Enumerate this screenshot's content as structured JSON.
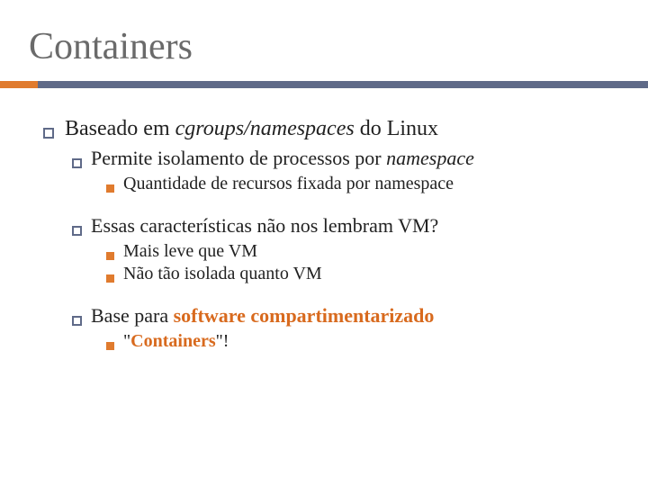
{
  "title": "Containers",
  "l1_prefix": "Baseado em ",
  "l1_emph": "cgroups/namespaces",
  "l1_suffix": " do Linux",
  "g1": {
    "l2_prefix": "Permite isolamento de processos por ",
    "l2_emph": "namespace",
    "l3_1": "Quantidade de recursos fixada por namespace"
  },
  "g2": {
    "l2": "Essas características não nos lembram VM?",
    "l3_1": "Mais leve que VM",
    "l3_2": "Não tão isolada quanto VM"
  },
  "g3": {
    "l2_prefix": "Base para ",
    "l2_accent": "software compartimentarizado",
    "l3_prefix": "\"",
    "l3_accent": "Containers",
    "l3_suffix": "\"!"
  }
}
